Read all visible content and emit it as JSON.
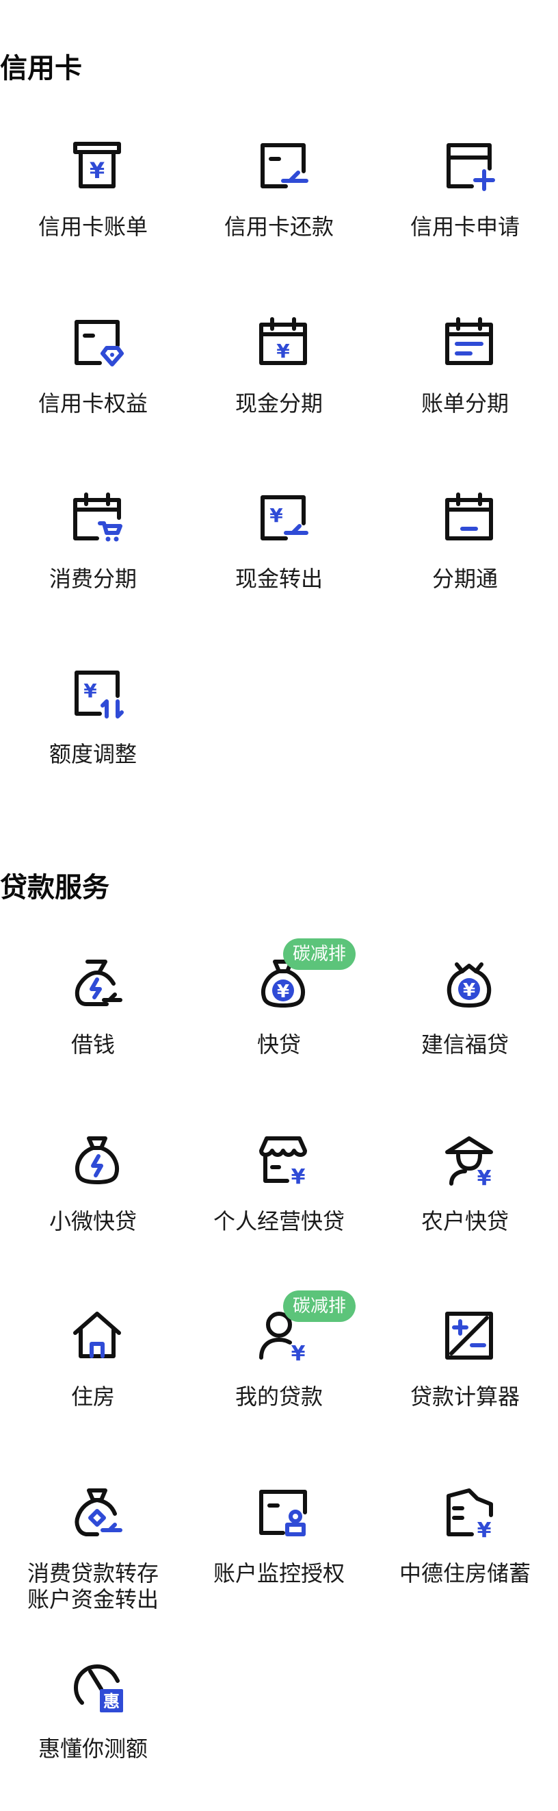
{
  "theme": {
    "accent": "#2f4bd6",
    "icon_outline": "#111111",
    "badge_color": "#5cc47a"
  },
  "sections": [
    {
      "title": "信用卡",
      "items": [
        {
          "label": "信用卡账单",
          "icon": "bill-icon"
        },
        {
          "label": "信用卡还款",
          "icon": "card-repay-icon"
        },
        {
          "label": "信用卡申请",
          "icon": "card-apply-icon"
        },
        {
          "label": "信用卡权益",
          "icon": "card-benefits-icon"
        },
        {
          "label": "现金分期",
          "icon": "cash-installment-icon"
        },
        {
          "label": "账单分期",
          "icon": "bill-installment-icon"
        },
        {
          "label": "消费分期",
          "icon": "consumption-installment-icon"
        },
        {
          "label": "现金转出",
          "icon": "cash-transfer-icon"
        },
        {
          "label": "分期通",
          "icon": "installment-pass-icon"
        },
        {
          "label": "额度调整",
          "icon": "limit-adjust-icon"
        }
      ]
    },
    {
      "title": "贷款服务",
      "items": [
        {
          "label": "借钱",
          "icon": "borrow-money-icon"
        },
        {
          "label": "快贷",
          "icon": "quick-loan-icon",
          "badge": "碳减排"
        },
        {
          "label": "建信福贷",
          "icon": "fortune-loan-icon"
        },
        {
          "label": "小微快贷",
          "icon": "micro-loan-icon"
        },
        {
          "label": "个人经营快贷",
          "icon": "business-loan-icon"
        },
        {
          "label": "农户快贷",
          "icon": "farmer-loan-icon"
        },
        {
          "label": "住房",
          "icon": "house-icon"
        },
        {
          "label": "我的贷款",
          "icon": "my-loan-icon",
          "badge": "碳减排"
        },
        {
          "label": "贷款计算器",
          "icon": "loan-calculator-icon"
        },
        {
          "label": "消费贷款转存",
          "label_line2": "账户资金转出",
          "icon": "consumer-loan-transfer-icon"
        },
        {
          "label": "账户监控授权",
          "icon": "account-monitor-icon"
        },
        {
          "label": "中德住房储蓄",
          "icon": "housing-savings-icon"
        },
        {
          "label": "惠懂你测额",
          "icon": "speedometer-icon",
          "icon_text": "惠"
        }
      ]
    }
  ]
}
